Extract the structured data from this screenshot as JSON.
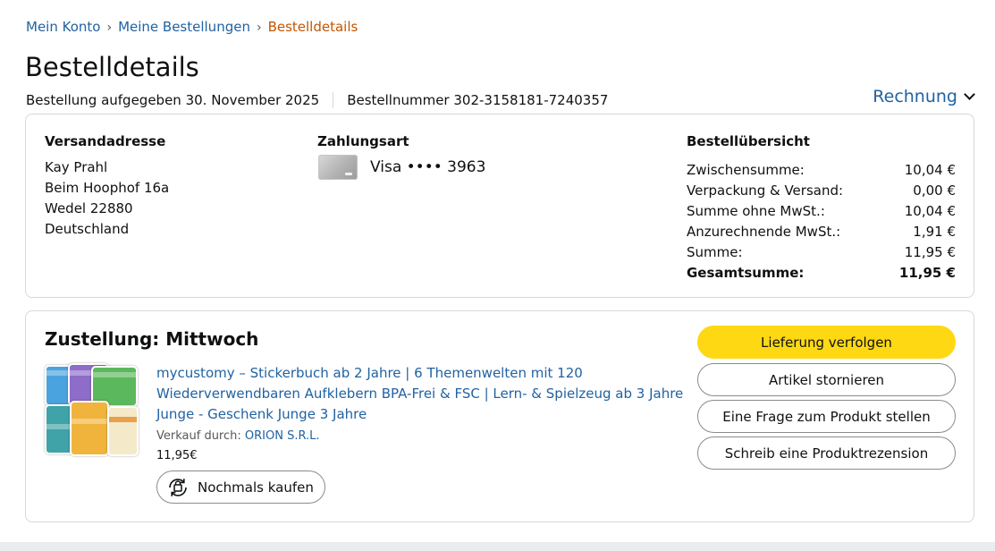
{
  "breadcrumb": {
    "item1": "Mein Konto",
    "item2": "Meine Bestellungen",
    "current": "Bestelldetails",
    "separator": "›"
  },
  "page_title": "Bestelldetails",
  "order": {
    "placed": "Bestellung aufgegeben 30. November 2025",
    "number": "Bestellnummer 302-3158181-7240357"
  },
  "invoice_label": "Rechnung",
  "shipping": {
    "heading": "Versandadresse",
    "lines": [
      "Kay Prahl",
      "Beim Hoophof 16a",
      "Wedel 22880",
      "Deutschland"
    ]
  },
  "payment": {
    "heading": "Zahlungsart",
    "method": "Visa •••• 3963"
  },
  "summary": {
    "heading": "Bestellübersicht",
    "rows": [
      {
        "label": "Zwischensumme:",
        "value": "10,04 €"
      },
      {
        "label": "Verpackung & Versand:",
        "value": "0,00 €"
      },
      {
        "label": "Summe ohne MwSt.:",
        "value": "10,04 €"
      },
      {
        "label": "Anzurechnende MwSt.:",
        "value": "1,91 €"
      },
      {
        "label": "Summe:",
        "value": "11,95 €"
      },
      {
        "label": "Gesamtsumme:",
        "value": "11,95 €"
      }
    ]
  },
  "delivery": {
    "title": "Zustellung: Mittwoch",
    "product_title": "mycustomy – Stickerbuch ab 2 Jahre | 6 Themenwelten mit 120 Wiederverwendbaren Aufklebern BPA-Frei & FSC | Lern- & Spielzeug ab 3 Jahre Junge - Geschenk Junge 3 Jahre",
    "seller_prefix": "Verkauf durch:",
    "seller_name": "ORION S.R.L.",
    "price": "11,95€",
    "rebuy_label": "Nochmals kaufen"
  },
  "actions": {
    "track": "Lieferung verfolgen",
    "cancel": "Artikel stornieren",
    "question": "Eine Frage zum Produkt stellen",
    "review": "Schreib eine Produktrezension"
  },
  "colors": {
    "link": "#2162a1",
    "breadcrumb_current": "#c45500",
    "primary_button": "#ffd814",
    "border": "#d5d9d9"
  }
}
